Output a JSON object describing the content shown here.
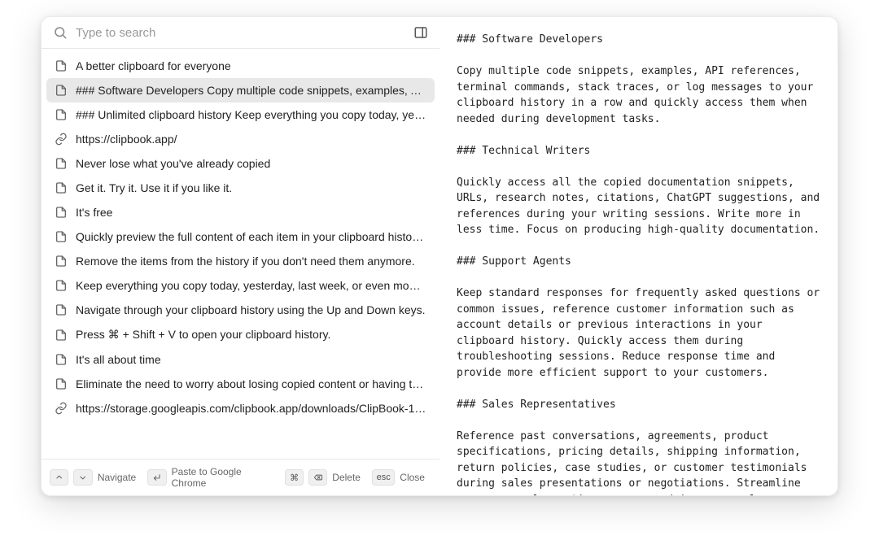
{
  "search": {
    "placeholder": "Type to search"
  },
  "panel_toggle_icon": "panel-right-icon",
  "items": [
    {
      "icon": "doc",
      "text": "A better clipboard for everyone",
      "selected": false
    },
    {
      "icon": "doc",
      "text": "### Software Developers Copy multiple code snippets, examples, API re…",
      "selected": true
    },
    {
      "icon": "doc",
      "text": "### Unlimited clipboard history Keep everything you copy today, yester…",
      "selected": false
    },
    {
      "icon": "link",
      "text": "https://clipbook.app/",
      "selected": false
    },
    {
      "icon": "doc",
      "text": "Never lose what you've already copied",
      "selected": false
    },
    {
      "icon": "doc",
      "text": "Get it. Try it. Use it if you like it.",
      "selected": false
    },
    {
      "icon": "doc",
      "text": "It's free",
      "selected": false
    },
    {
      "icon": "doc",
      "text": "Quickly preview the full content of each item in your clipboard history to …",
      "selected": false
    },
    {
      "icon": "doc",
      "text": "Remove the items from the history if you don't need them anymore.",
      "selected": false
    },
    {
      "icon": "doc",
      "text": "Keep everything you copy today, yesterday, last week, or even months a…",
      "selected": false
    },
    {
      "icon": "doc",
      "text": "Navigate through your clipboard history using the Up and Down keys.",
      "selected": false
    },
    {
      "icon": "doc",
      "text": "Press ⌘ + Shift + V to open your clipboard history.",
      "selected": false
    },
    {
      "icon": "doc",
      "text": "It's all about time",
      "selected": false
    },
    {
      "icon": "doc",
      "text": "Eliminate the need to worry about losing copied content or having to re-…",
      "selected": false
    },
    {
      "icon": "link",
      "text": "https://storage.googleapis.com/clipbook.app/downloads/ClipBook-1.2.0-…",
      "selected": false
    }
  ],
  "footer": {
    "navigate": "Navigate",
    "paste": "Paste to Google Chrome",
    "delete": "Delete",
    "close": "Close",
    "cmd": "⌘",
    "esc": "esc"
  },
  "preview": "### Software Developers\n\nCopy multiple code snippets, examples, API references, terminal commands, stack traces, or log messages to your clipboard history in a row and quickly access them when needed during development tasks.\n\n### Technical Writers\n\nQuickly access all the copied documentation snippets, URLs, research notes, citations, ChatGPT suggestions, and references during your writing sessions. Write more in less time. Focus on producing high-quality documentation.\n\n### Support Agents\n\nKeep standard responses for frequently asked questions or common issues, reference customer information such as account details or previous interactions in your clipboard history. Quickly access them during troubleshooting sessions. Reduce response time and provide more efficient support to your customers.\n\n### Sales Representatives\n\nReference past conversations, agreements, product specifications, pricing details, shipping information, return policies, case studies, or customer testimonials during sales presentations or negotiations. Streamline your proposal creation process and increase sales effectiveness.\n\n### Lawyers\n\nStore and access contracts, agreements, legal citations, standard clauses, statutes, boilerplate language, or case law excerpts during legal research. Minimize repetitive typing. Save"
}
